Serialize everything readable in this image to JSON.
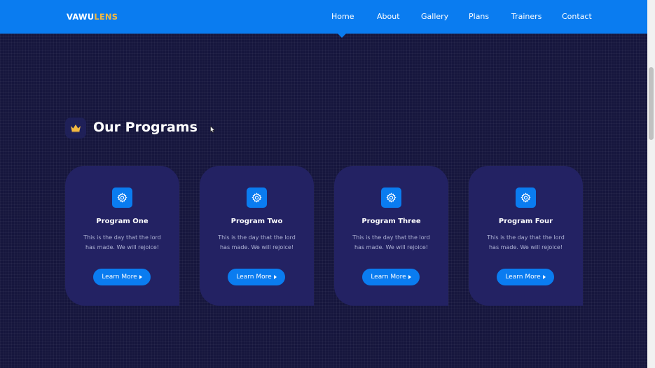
{
  "brand": {
    "part1": "VAWU",
    "part2": "LENS",
    "accent_color": "#f5b940"
  },
  "nav": {
    "background": "#0a7cf0",
    "items": [
      {
        "label": "Home",
        "active": true
      },
      {
        "label": "About"
      },
      {
        "label": "Gallery"
      },
      {
        "label": "Plans"
      },
      {
        "label": "Trainers"
      },
      {
        "label": "Contact"
      }
    ]
  },
  "section": {
    "title": "Our Programs",
    "icon": "crown-icon"
  },
  "cards": [
    {
      "title": "Program One",
      "desc": "This is the day that the lord has made. We will rejoice!",
      "button": "Learn More",
      "icon": "gear-icon"
    },
    {
      "title": "Program Two",
      "desc": "This is the day that the lord has made. We will rejoice!",
      "button": "Learn More",
      "icon": "gear-icon"
    },
    {
      "title": "Program Three",
      "desc": "This is the day that the lord has made. We will rejoice!",
      "button": "Learn More",
      "icon": "gear-icon"
    },
    {
      "title": "Program Four",
      "desc": "This is the day that the lord has made. We will rejoice!",
      "button": "Learn More",
      "icon": "gear-icon"
    }
  ],
  "colors": {
    "page_bg": "#16163d",
    "card_bg": "#232263",
    "accent": "#0a7cf0"
  }
}
